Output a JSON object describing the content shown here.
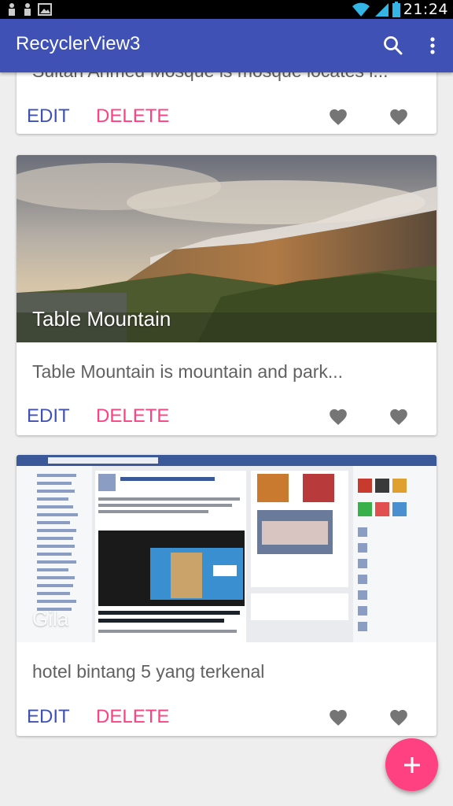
{
  "status_bar": {
    "time": "21:24"
  },
  "app_bar": {
    "title": "RecyclerView3",
    "search_icon": "search-icon",
    "more_icon": "more-vert-icon"
  },
  "cards": [
    {
      "description": "Sultan Ahmed Mosque is mosque locates i...",
      "edit_label": "EDIT",
      "delete_label": "DELETE"
    },
    {
      "image_title": "Table Mountain",
      "description": "Table Mountain is mountain and park...",
      "edit_label": "EDIT",
      "delete_label": "DELETE"
    },
    {
      "image_title": "Gila",
      "description": "hotel bintang 5 yang terkenal",
      "edit_label": "EDIT",
      "delete_label": "DELETE"
    }
  ],
  "fab": {
    "label": "+"
  },
  "colors": {
    "primary": "#3f51b5",
    "accent": "#ff4081",
    "heart": "#757575"
  }
}
